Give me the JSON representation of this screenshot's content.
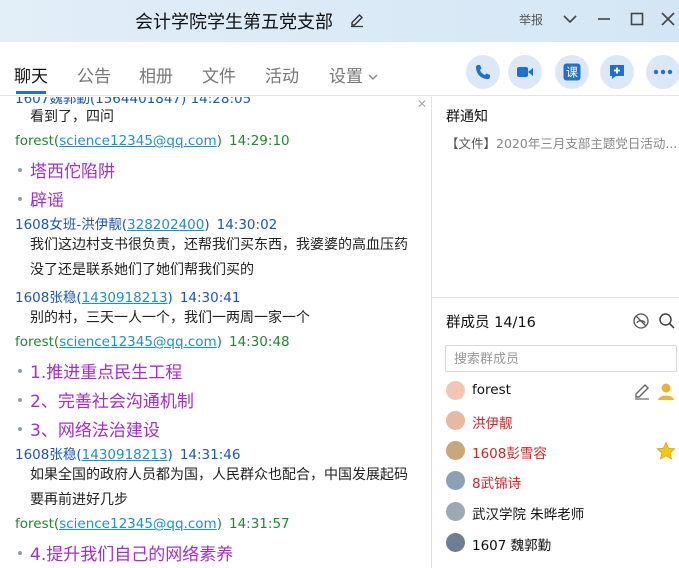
{
  "window": {
    "title": "会计学院学生第五党支部",
    "report_label": "举报"
  },
  "tabs": [
    {
      "label": "聊天"
    },
    {
      "label": "公告"
    },
    {
      "label": "相册"
    },
    {
      "label": "文件"
    },
    {
      "label": "活动"
    },
    {
      "label": "设置"
    }
  ],
  "actions": [
    "phone-icon",
    "video-icon",
    "course-icon",
    "add-chat-icon",
    "more-icon"
  ],
  "chat": {
    "top_cut": "1607魏郭勤(1564401847) 14:28:05",
    "messages": [
      {
        "kind": "text",
        "text": "看到了，四问"
      },
      {
        "kind": "sender",
        "name": "forest",
        "account": "science12345@qq.com",
        "time": "14:29:10"
      },
      {
        "kind": "bullet",
        "text": "塔西佗陷阱"
      },
      {
        "kind": "bullet",
        "text": "辟谣"
      },
      {
        "kind": "sender",
        "name": "1608女班-洪伊靓",
        "account": "328202400",
        "time": "14:30:02"
      },
      {
        "kind": "text",
        "text": "我们这边村支书很负责，还帮我们买东西，我婆婆的高血压药没了还是联系她们了她们帮我们买的"
      },
      {
        "kind": "sender",
        "name": "1608张稳",
        "account": "1430918213",
        "time": "14:30:41"
      },
      {
        "kind": "text",
        "text": "别的村，三天一人一个，我们一两周一家一个"
      },
      {
        "kind": "sender",
        "name": "forest",
        "account": "science12345@qq.com",
        "time": "14:30:48"
      },
      {
        "kind": "bullet",
        "text": "1.推进重点民生工程"
      },
      {
        "kind": "bullet",
        "text": "2、完善社会沟通机制"
      },
      {
        "kind": "bullet",
        "text": "3、网络法治建设"
      },
      {
        "kind": "sender",
        "name": "1608张稳",
        "account": "1430918213",
        "time": "14:31:46"
      },
      {
        "kind": "text",
        "text": "如果全国的政府人员都为国，人民群众也配合，中国发展起码要再前进好几步"
      },
      {
        "kind": "sender",
        "name": "forest",
        "account": "science12345@qq.com",
        "time": "14:31:57"
      },
      {
        "kind": "bullet",
        "text": "4.提升我们自己的网络素养"
      }
    ]
  },
  "notice": {
    "title": "群通知",
    "file_tag": "【文件】",
    "file_text": "2020年三月支部主题党日活动..."
  },
  "members": {
    "title": "群成员 14/16",
    "search_placeholder": "搜索群成员",
    "list": [
      {
        "name": "forest",
        "color": "#111111",
        "avatar": "#f3c6b4"
      },
      {
        "name": "洪伊靓",
        "color": "#d42424",
        "avatar": "#e7b8a2"
      },
      {
        "name": "1608彭雪容",
        "color": "#d42424",
        "avatar": "#c9a77a"
      },
      {
        "name": "8武锦诗",
        "color": "#d42424",
        "avatar": "#8aa2b8"
      },
      {
        "name": "武汉学院 朱晔老师",
        "color": "#111111",
        "avatar": "#9aa9b2"
      },
      {
        "name": "1607 魏郭勤",
        "color": "#111111",
        "avatar": "#6d7f95"
      }
    ]
  }
}
